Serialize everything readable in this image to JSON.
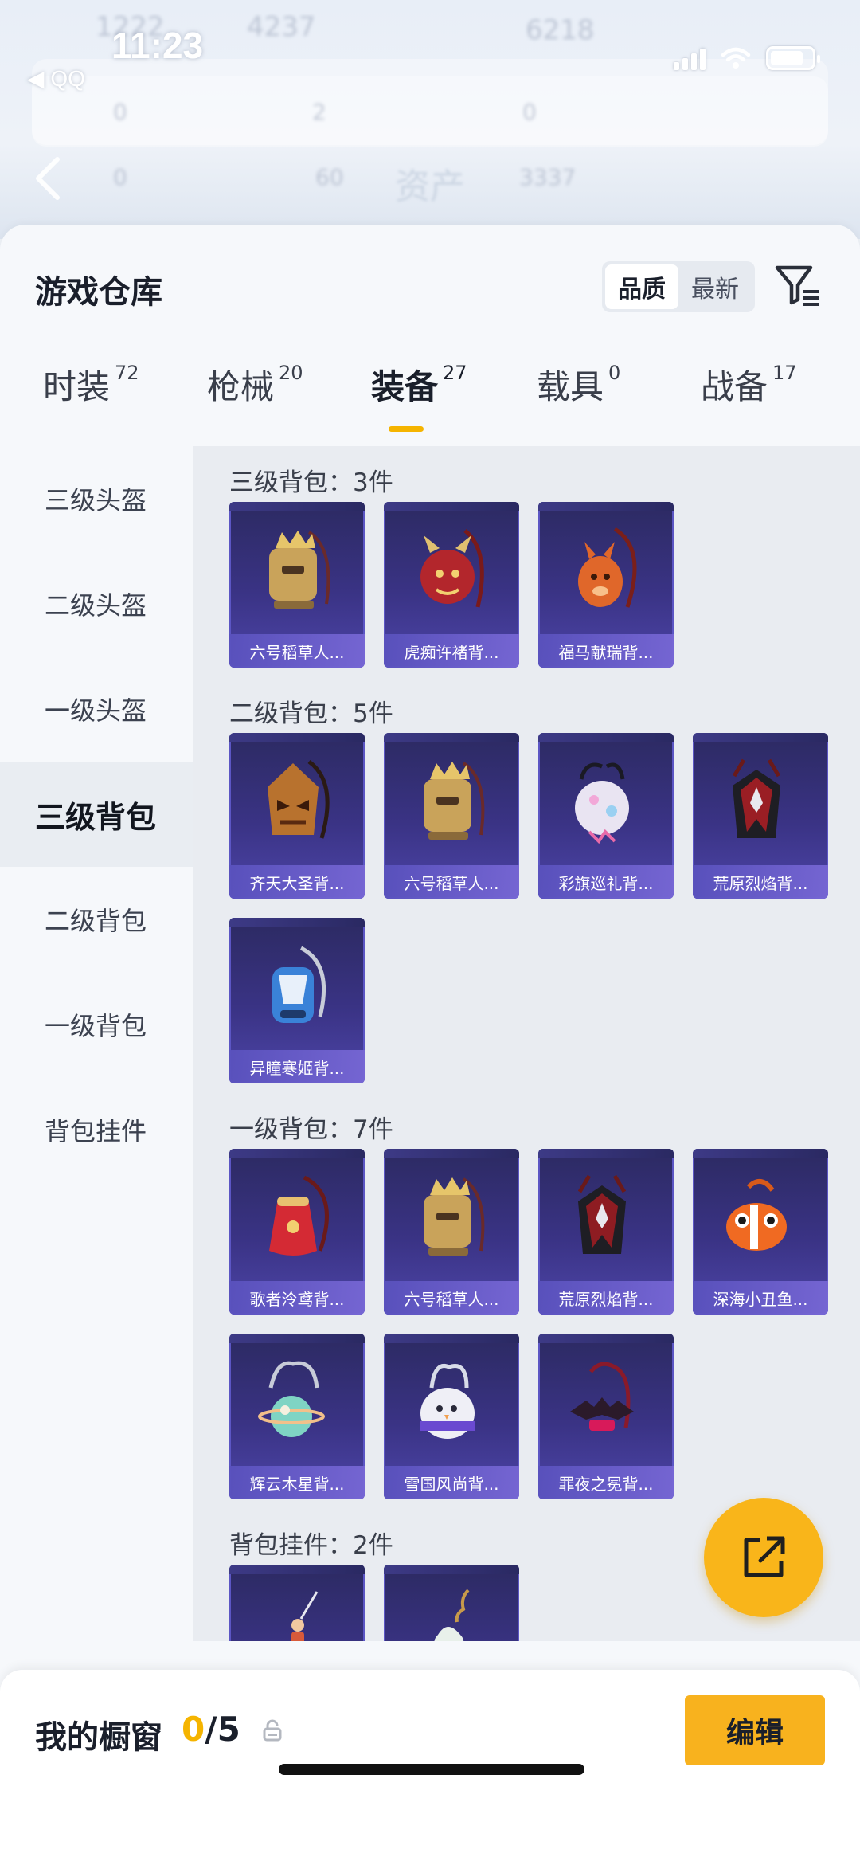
{
  "status_bar": {
    "time": "11:23",
    "back_app": "◀ QQ"
  },
  "background": {
    "title": "资产",
    "ghost_stats": [
      "1222",
      "4237",
      "6218",
      "0",
      "2",
      "0",
      "0",
      "60",
      "3337"
    ]
  },
  "header": {
    "title": "游戏仓库",
    "sort_options": [
      "品质",
      "最新"
    ],
    "active_sort": "品质"
  },
  "tabs": [
    {
      "label": "时装",
      "count": "72",
      "active": false
    },
    {
      "label": "枪械",
      "count": "20",
      "active": false
    },
    {
      "label": "装备",
      "count": "27",
      "active": true
    },
    {
      "label": "载具",
      "count": "0",
      "active": false
    },
    {
      "label": "战备",
      "count": "17",
      "active": false
    }
  ],
  "sidebar": {
    "items": [
      {
        "label": "三级头盔",
        "active": false
      },
      {
        "label": "二级头盔",
        "active": false
      },
      {
        "label": "一级头盔",
        "active": false
      },
      {
        "label": "三级背包",
        "active": true
      },
      {
        "label": "二级背包",
        "active": false
      },
      {
        "label": "一级背包",
        "active": false
      },
      {
        "label": "背包挂件",
        "active": false
      }
    ]
  },
  "sections": [
    {
      "title": "三级背包：3件",
      "items": [
        {
          "name": "六号稻草人...",
          "art": "scarecrow-backpack-icon",
          "color": "#c9a35a"
        },
        {
          "name": "虎痴许褚背...",
          "art": "tiger-backpack-icon",
          "color": "#b3262c"
        },
        {
          "name": "福马献瑞背...",
          "art": "horse-backpack-icon",
          "color": "#e0672a"
        }
      ]
    },
    {
      "title": "二级背包：5件",
      "items": [
        {
          "name": "齐天大圣背...",
          "art": "monkey-king-backpack-icon",
          "color": "#b8722e"
        },
        {
          "name": "六号稻草人...",
          "art": "scarecrow-backpack-icon",
          "color": "#c9a35a"
        },
        {
          "name": "彩旗巡礼背...",
          "art": "flag-backpack-icon",
          "color": "#e9e4f2"
        },
        {
          "name": "荒原烈焰背...",
          "art": "flame-backpack-icon",
          "color": "#9a1e24"
        },
        {
          "name": "异瞳寒姬背...",
          "art": "frost-backpack-icon",
          "color": "#3a82d8"
        }
      ]
    },
    {
      "title": "一级背包：7件",
      "items": [
        {
          "name": "歌者泠鸢背...",
          "art": "pouch-backpack-icon",
          "color": "#d42a34"
        },
        {
          "name": "六号稻草人...",
          "art": "scarecrow-backpack-icon",
          "color": "#c9a35a"
        },
        {
          "name": "荒原烈焰背...",
          "art": "flame-backpack-icon",
          "color": "#8e1c22"
        },
        {
          "name": "深海小丑鱼...",
          "art": "clownfish-backpack-icon",
          "color": "#f06a22"
        },
        {
          "name": "辉云木星背...",
          "art": "planet-backpack-icon",
          "color": "#7fd4c4"
        },
        {
          "name": "雪国风尚背...",
          "art": "snow-backpack-icon",
          "color": "#efeff6"
        },
        {
          "name": "罪夜之冕背...",
          "art": "bat-backpack-icon",
          "color": "#2b1a2a"
        }
      ]
    },
    {
      "title": "背包挂件：2件",
      "items": [
        {
          "name": "",
          "art": "figure-charm-icon",
          "color": "#d85a3a"
        },
        {
          "name": "",
          "art": "icecream-charm-icon",
          "color": "#e8f0ea"
        }
      ]
    }
  ],
  "bottom_bar": {
    "label": "我的橱窗",
    "current": "0",
    "total": "/5",
    "edit_label": "编辑"
  },
  "colors": {
    "accent": "#f5b400",
    "card_bg": "#3a3385",
    "card_label": "#6b5fd0"
  }
}
